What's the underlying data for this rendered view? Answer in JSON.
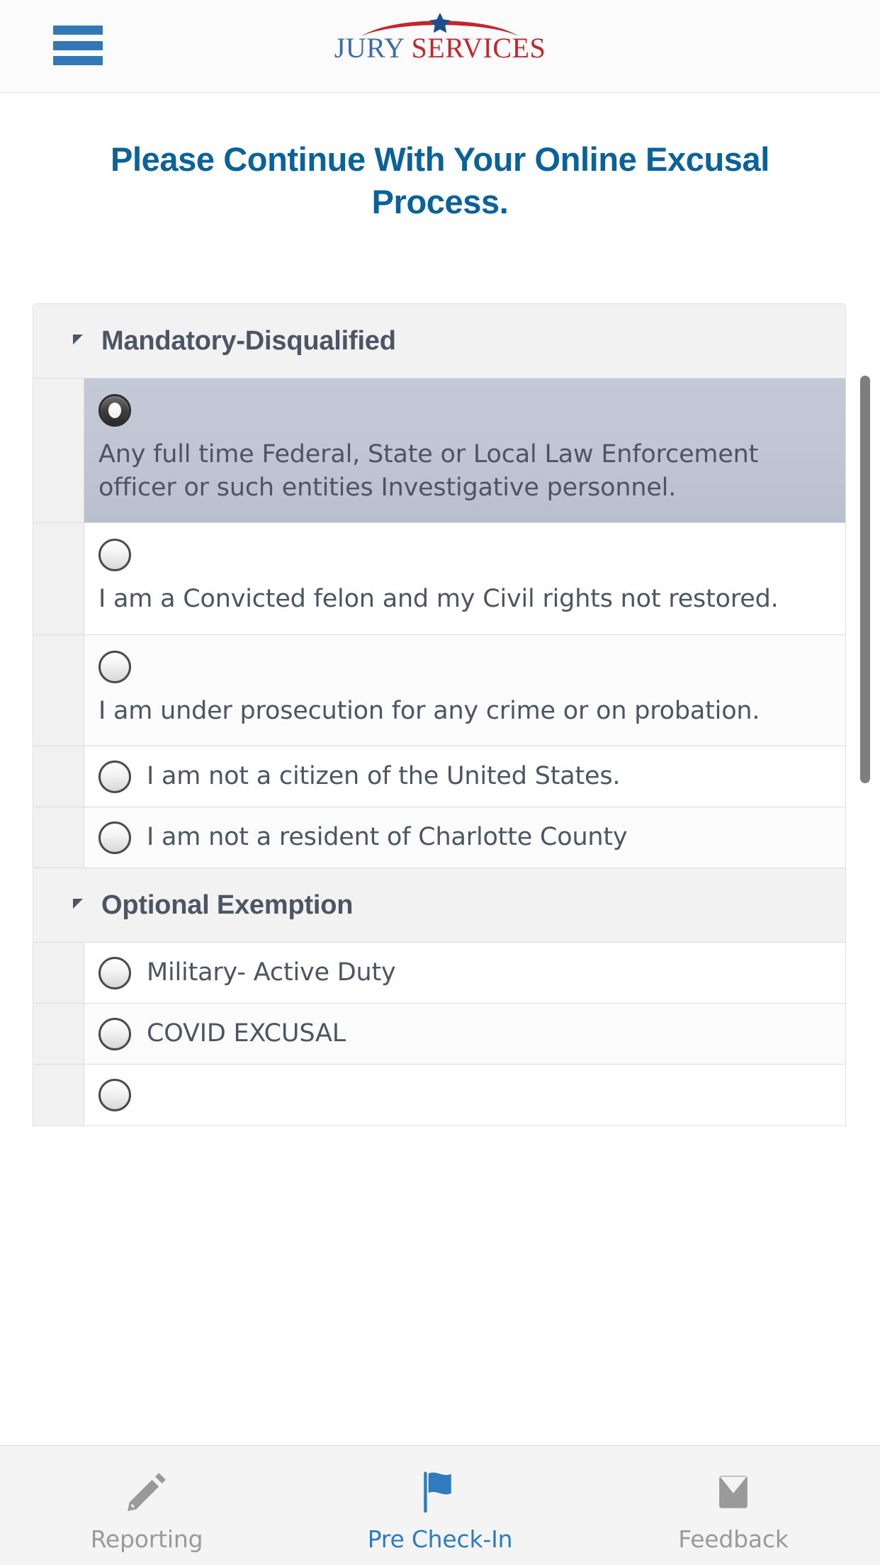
{
  "header": {
    "menu_icon": "hamburger-menu-icon",
    "logo": {
      "word1": "JURY",
      "word2": "SERVICES",
      "word1_color": "#3a6ea5",
      "word2_color": "#c1272d",
      "arc_color": "#c1272d",
      "star_color": "#1f4e8c"
    },
    "menu_color": "#3178b5"
  },
  "page": {
    "title": "Please Continue With Your Online Excusal Process.",
    "title_color": "#0a6299"
  },
  "sections": [
    {
      "id": "mandatory-disqualified",
      "label": "Mandatory-Disqualified",
      "expanded": true,
      "caret_icon": "caret-collapse-icon",
      "options": [
        {
          "label": "Any full time Federal, State or Local Law Enforcement officer or such entities Investigative personnel.",
          "selected": true,
          "layout": "stacked"
        },
        {
          "label": "I am a Convicted felon and my Civil rights not restored.",
          "selected": false,
          "layout": "stacked"
        },
        {
          "label": "I am under prosecution for any crime or on probation.",
          "selected": false,
          "layout": "stacked"
        },
        {
          "label": "I am not a citizen of the United States.",
          "selected": false,
          "layout": "inline"
        },
        {
          "label": "I am not a resident of Charlotte County",
          "selected": false,
          "layout": "inline"
        }
      ]
    },
    {
      "id": "optional-exemption",
      "label": "Optional Exemption",
      "expanded": true,
      "caret_icon": "caret-collapse-icon",
      "options": [
        {
          "label": "Military- Active Duty",
          "selected": false,
          "layout": "inline"
        },
        {
          "label": "COVID EXCUSAL",
          "selected": false,
          "layout": "inline"
        },
        {
          "label": "",
          "selected": false,
          "layout": "inline"
        }
      ]
    }
  ],
  "scrollbar": {
    "visible": true,
    "color": "#7e7e7e"
  },
  "bottom_nav": {
    "active_color": "#2f7bc0",
    "inactive_color": "#9a9a9a",
    "items": [
      {
        "label": "Reporting",
        "icon": "pencil-icon",
        "active": false
      },
      {
        "label": "Pre Check-In",
        "icon": "flag-icon",
        "active": true
      },
      {
        "label": "Feedback",
        "icon": "envelope-icon",
        "active": false
      }
    ]
  }
}
